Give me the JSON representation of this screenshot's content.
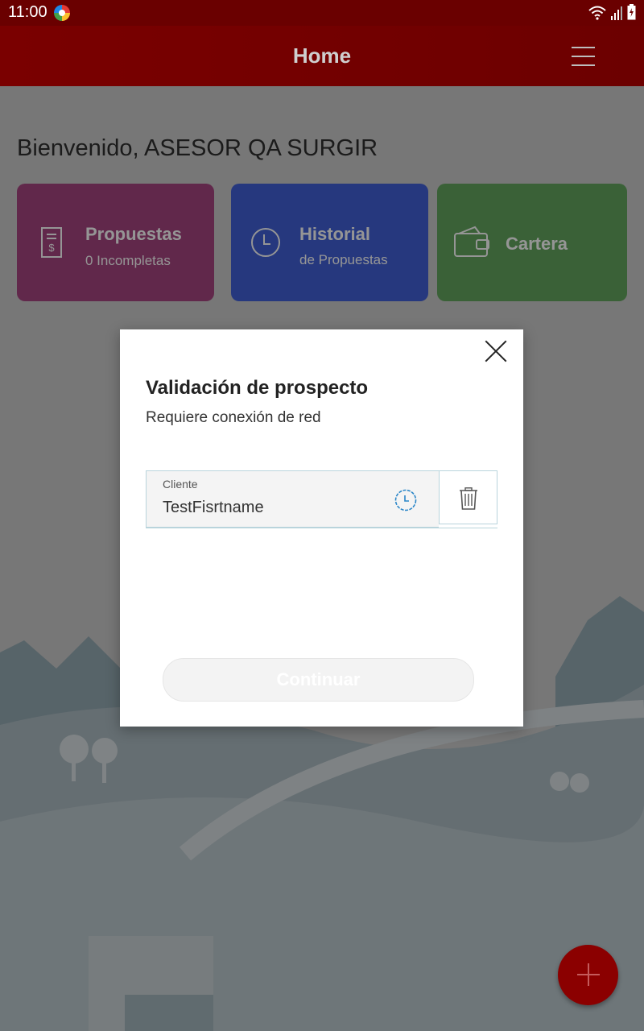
{
  "status_bar": {
    "time": "11:00"
  },
  "app_bar": {
    "title": "Home"
  },
  "home": {
    "welcome": "Bienvenido, ASESOR QA SURGIR",
    "cards": [
      {
        "title": "Propuestas",
        "subtitle": "0  Incompletas",
        "color": "#a03a78"
      },
      {
        "title": "Historial",
        "subtitle": "de Propuestas",
        "color": "#3557d6"
      },
      {
        "title": "Cartera",
        "subtitle": "",
        "color": "#5aa055"
      }
    ]
  },
  "modal": {
    "title": "Validación de prospecto",
    "subtitle": "Requiere conexión de red",
    "field": {
      "label": "Cliente",
      "value": "TestFisrtname"
    },
    "continue_label": "Continuar",
    "accent": "#2a86c8"
  },
  "colors": {
    "brand": "#7a0000",
    "fab": "#8b0000"
  }
}
